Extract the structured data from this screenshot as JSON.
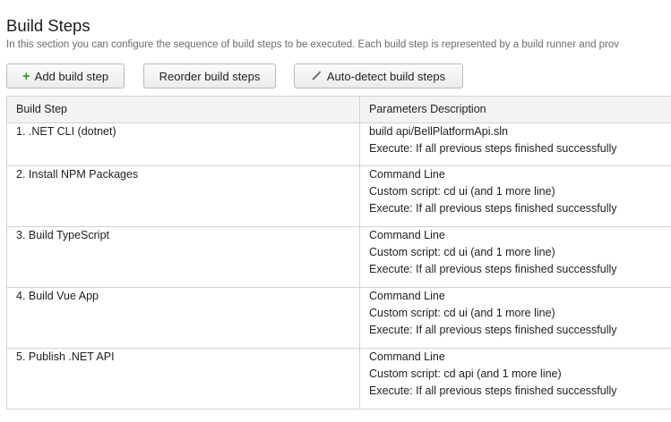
{
  "section": {
    "title": "Build Steps",
    "description": "In this section you can configure the sequence of build steps to be executed. Each build step is represented by a build runner and prov"
  },
  "toolbar": {
    "add_label": "Add build step",
    "reorder_label": "Reorder build steps",
    "detect_label": "Auto-detect build steps"
  },
  "table": {
    "headers": [
      "Build Step",
      "Parameters Description"
    ],
    "rows": [
      {
        "step": "1. .NET CLI (dotnet)",
        "params": [
          "build api/BellPlatformApi.sln",
          "Execute: If all previous steps finished successfully"
        ]
      },
      {
        "step": "2. Install NPM Packages",
        "params": [
          "Command Line",
          "Custom script: cd ui (and 1 more line)",
          "Execute: If all previous steps finished successfully"
        ]
      },
      {
        "step": "3. Build TypeScript",
        "params": [
          "Command Line",
          "Custom script: cd ui (and 1 more line)",
          "Execute: If all previous steps finished successfully"
        ]
      },
      {
        "step": "4. Build Vue App",
        "params": [
          "Command Line",
          "Custom script: cd ui (and 1 more line)",
          "Execute: If all previous steps finished successfully"
        ]
      },
      {
        "step": "5. Publish .NET API",
        "params": [
          "Command Line",
          "Custom script: cd api (and 1 more line)",
          "Execute: If all previous steps finished successfully"
        ]
      }
    ]
  },
  "icons": {
    "add": "plus-icon",
    "detect": "magic-wand-icon"
  },
  "colors": {
    "add_icon": "#2c9a2c",
    "header_bg": "#f3f3f3",
    "border": "#d3d3d3"
  }
}
